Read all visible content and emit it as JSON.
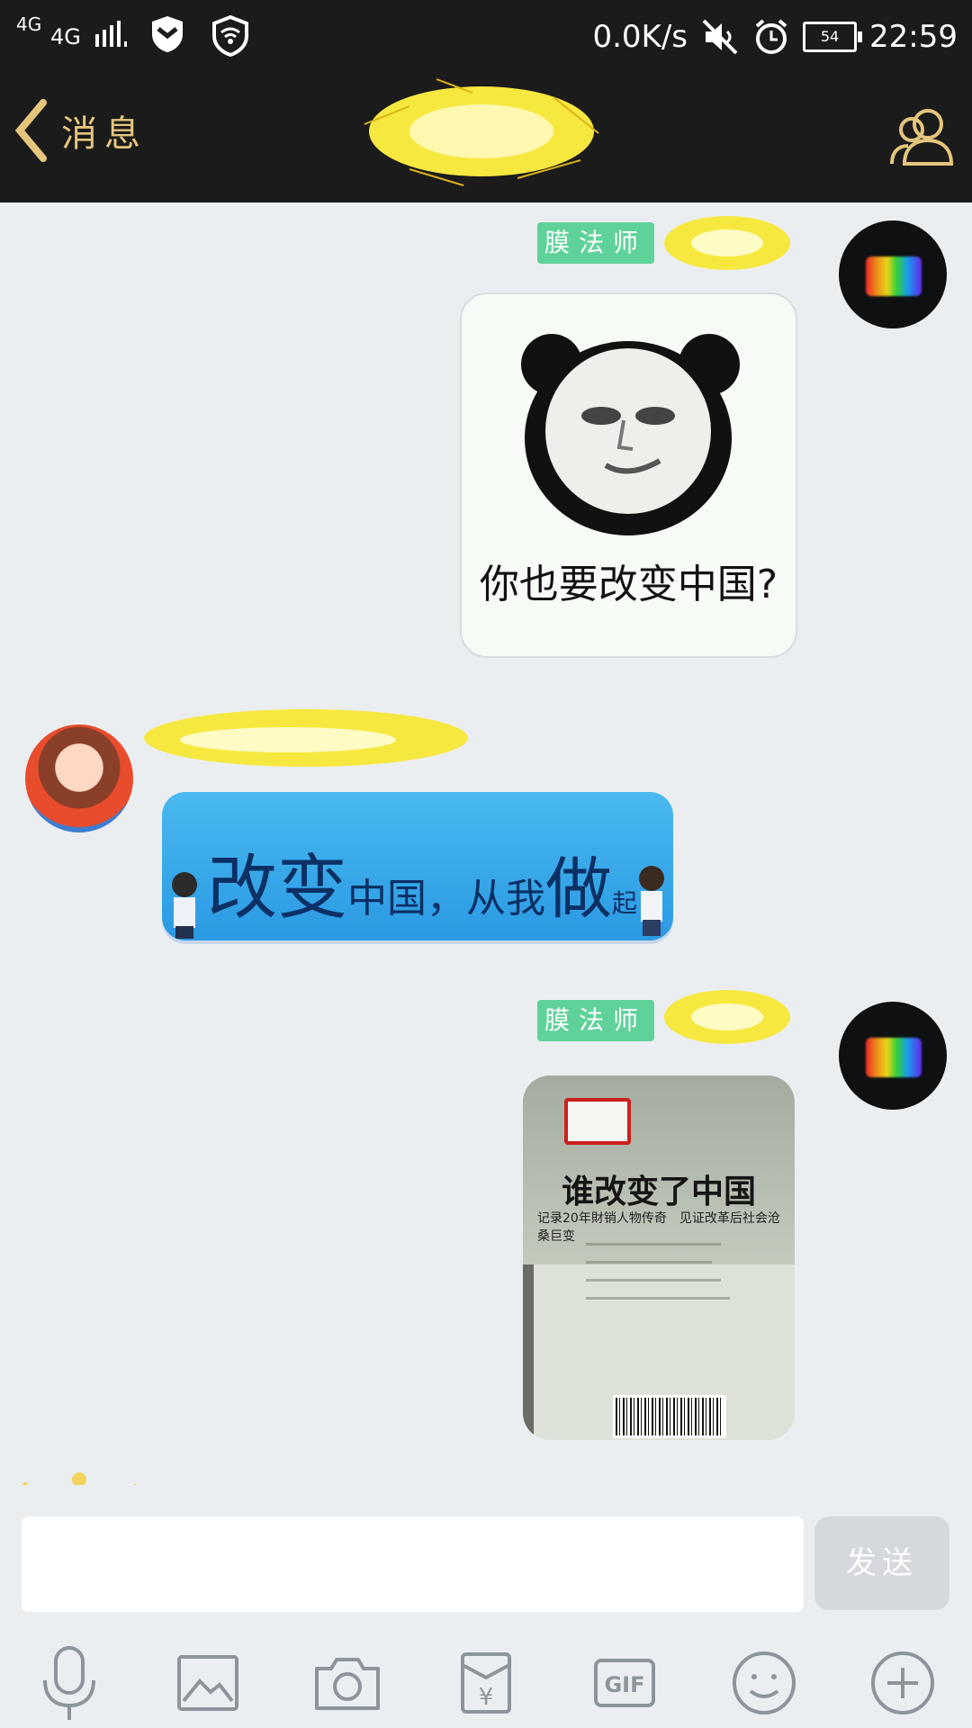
{
  "status_bar": {
    "network_top": "4G",
    "network_main": "4G",
    "speed": "0.0K/s",
    "battery": "54",
    "time": "22:59"
  },
  "nav": {
    "back_label": "消息"
  },
  "messages": [
    {
      "sender": "self",
      "badge": "膜法师",
      "caption": "你也要改变中国?"
    },
    {
      "sender": "other",
      "slogan_part1": "改变",
      "slogan_part2": "中国，从我",
      "slogan_part3": "做",
      "slogan_part4": "起"
    },
    {
      "sender": "self",
      "badge": "膜法师",
      "book_title": "谁改变了中国",
      "book_subtitle": "记录20年財销人物传奇　见证改革后社会沧桑巨变"
    }
  ],
  "composer": {
    "placeholder": "",
    "send_label": "发送"
  },
  "toolbar": {
    "gif_label": "GIF",
    "red_packet_symbol": "¥"
  },
  "colors": {
    "bg": "#ebeef1",
    "nav": "#1b1b1b",
    "gold": "#e5c57c",
    "badge": "#5fd29a"
  }
}
